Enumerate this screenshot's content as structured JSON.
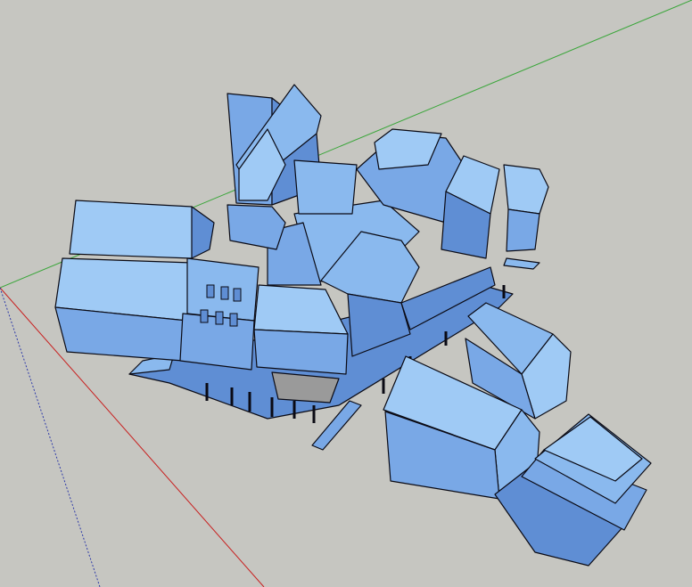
{
  "viewport": {
    "background": "#c6c6c1",
    "axes": {
      "green": "#3aa63a",
      "red": "#c81e1e",
      "blue": "#2e3aa8"
    },
    "model": {
      "colors": {
        "top": "#9fcaf5",
        "light": "#8ab9ee",
        "mid": "#79a8e6",
        "dark": "#5f8ed4",
        "shadow": "#4e78b8",
        "outline": "#0a0a14",
        "hatch": "#9a9a9a"
      }
    }
  }
}
